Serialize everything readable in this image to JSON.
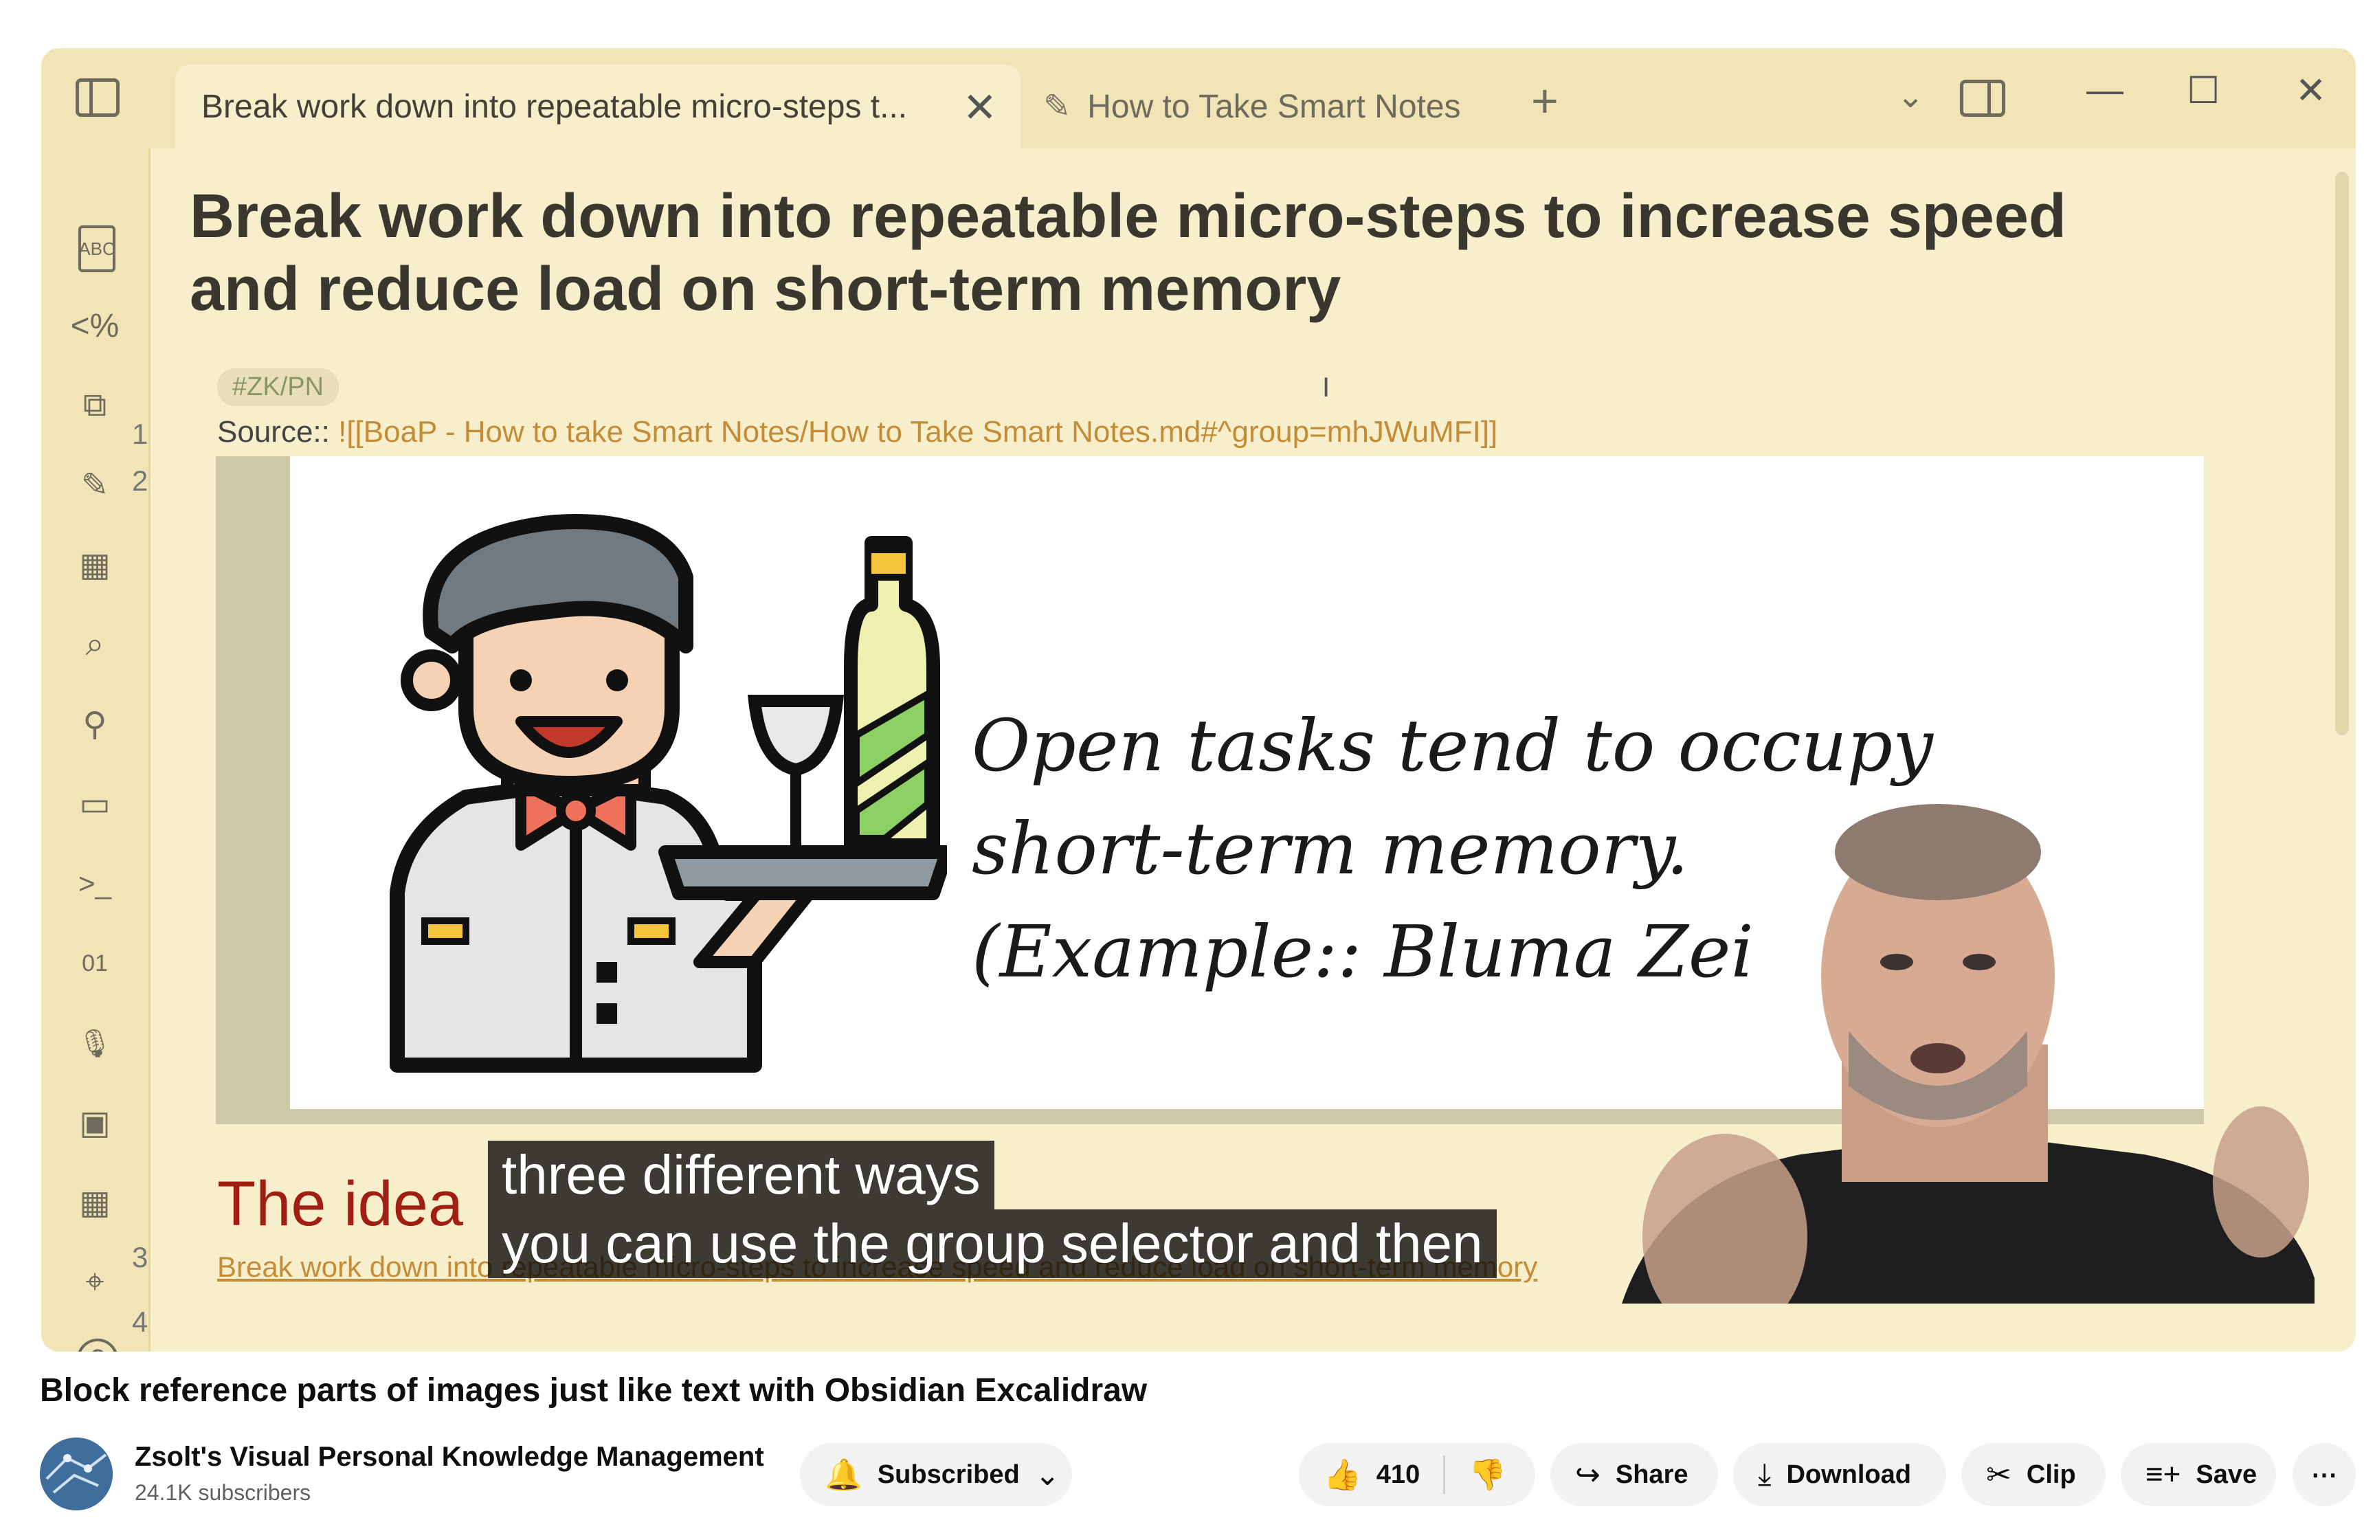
{
  "window": {
    "tabs": [
      {
        "label": "Break work down into repeatable micro-steps t...",
        "close": "✕",
        "active": true
      },
      {
        "label": "How to Take Smart Notes",
        "active": false
      }
    ],
    "new_tab": "+",
    "tab_list": "⌄",
    "minimize": "—",
    "maximize": "☐",
    "close": "✕"
  },
  "ribbon": {
    "icons": [
      "spellcheck-icon",
      "template-icon",
      "copy-icon",
      "excalidraw-icon",
      "table-icon",
      "search-file-icon",
      "graph-icon",
      "calendar-icon",
      "terminal-icon",
      "binary-icon",
      "microphone-icon",
      "layout-icon",
      "calendar-grid-icon",
      "map-pin-icon",
      "help-icon"
    ],
    "glyphs": [
      "ABC",
      "<%",
      "⧉",
      "✎",
      "▦",
      "⌕",
      "⚲",
      "▭",
      ">_",
      "01",
      "🎙",
      "▣",
      "▦",
      "⌖",
      "?"
    ]
  },
  "note": {
    "title": "Break work down into repeatable micro-steps to increase speed and reduce load on short-term memory",
    "line_numbers": [
      "1",
      "2",
      "3",
      "4"
    ],
    "tag": "#ZK/PN",
    "source_label": "Source:: ",
    "source_link": "![[BoaP - How to take Smart Notes/How to Take Smart Notes.md#^group=mhJWuMFI]]",
    "cursor": "I",
    "embed_text": "Open tasks tend to occupy\nshort-term memory.\n(Example:: Bluma Zei",
    "heading": "The idea",
    "idea_link": "Break work down into repeatable micro-steps to increase speed and reduce load on short-term memory"
  },
  "captions": [
    "three different ways",
    "you can use the group selector and then"
  ],
  "video": {
    "title": "Block reference parts of images just like text with Obsidian Excalidraw",
    "channel": "Zsolt's Visual Personal Knowledge Management",
    "subscribers": "24.1K subscribers",
    "subscribe_label": "Subscribed",
    "likes": "410",
    "share": "Share",
    "download": "Download",
    "clip": "Clip",
    "save": "Save",
    "more": "⋯"
  },
  "colors": {
    "editor_bg": "#f7eecb",
    "titlebar_bg": "#f1e5b7",
    "link": "#c48c36",
    "heading_red": "#a01e12"
  }
}
